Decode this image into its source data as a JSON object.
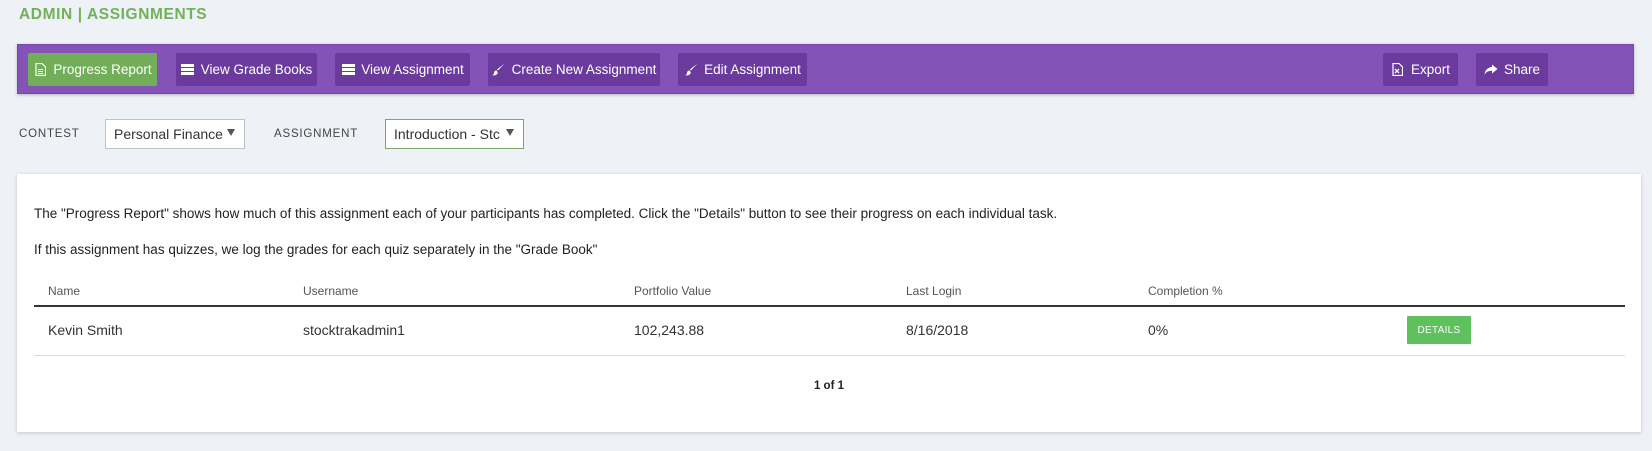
{
  "page": {
    "title": "ADMIN | ASSIGNMENTS"
  },
  "toolbar": {
    "buttons": [
      {
        "label": "Progress Report",
        "icon": "document-icon",
        "active": true
      },
      {
        "label": "View Grade Books",
        "icon": "list-icon",
        "active": false
      },
      {
        "label": "View Assignment",
        "icon": "list-icon",
        "active": false
      },
      {
        "label": "Create New Assignment",
        "icon": "brush-icon",
        "active": false
      },
      {
        "label": "Edit Assignment",
        "icon": "brush-icon",
        "active": false
      },
      {
        "label": "Export",
        "icon": "export-icon",
        "active": false
      },
      {
        "label": "Share",
        "icon": "share-icon",
        "active": false
      }
    ]
  },
  "filters": {
    "contest_label": "CONTEST",
    "contest_value": "Personal Finance",
    "assignment_label": "ASSIGNMENT",
    "assignment_value": "Introduction - Stc"
  },
  "panel": {
    "description_1": "The \"Progress Report\" shows how much of this assignment each of your participants has completed. Click the \"Details\" button to see their progress on each individual task.",
    "description_2": "If this assignment has quizzes, we log the grades for each quiz separately in the \"Grade Book\"",
    "table": {
      "columns": [
        "Name",
        "Username",
        "Portfolio Value",
        "Last Login",
        "Completion %"
      ],
      "rows": [
        {
          "name": "Kevin Smith",
          "username": "stocktrakadmin1",
          "portfolio_value": "102,243.88",
          "last_login": "8/16/2018",
          "completion": "0%",
          "action": "DETAILS"
        }
      ]
    },
    "pagination": "1 of 1"
  },
  "colors": {
    "accent_green": "#72ad59",
    "toolbar_purple": "#8553b8",
    "button_purple": "#6a3a9c",
    "details_green": "#5fc05e"
  }
}
